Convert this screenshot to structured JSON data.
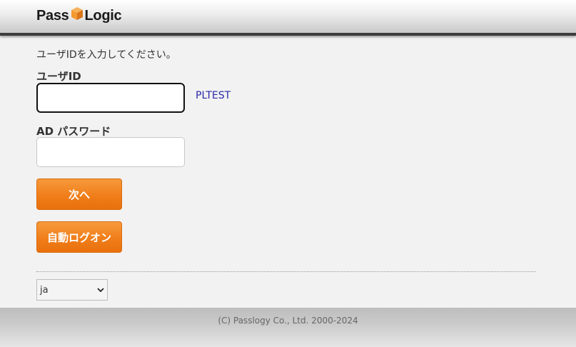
{
  "header": {
    "logo_left": "Pass",
    "logo_right": "Logic",
    "brand_colors": {
      "cube": "#f39a2e",
      "cube_dark": "#d9761a"
    }
  },
  "form": {
    "instruction": "ユーザIDを入力してください。",
    "userid_label": "ユーザID",
    "userid_value": "",
    "domain_text": "PLTEST",
    "password_label": "AD パスワード",
    "password_value": "",
    "next_button": "次へ",
    "auto_logon_button": "自動ログオン"
  },
  "language_select": {
    "selected": "ja"
  },
  "footer": {
    "copyright": "(C) Passlogy Co., Ltd. 2000-2024"
  },
  "colors": {
    "accent_orange": "#f07e1a",
    "link_blue": "#2a2aa8"
  }
}
